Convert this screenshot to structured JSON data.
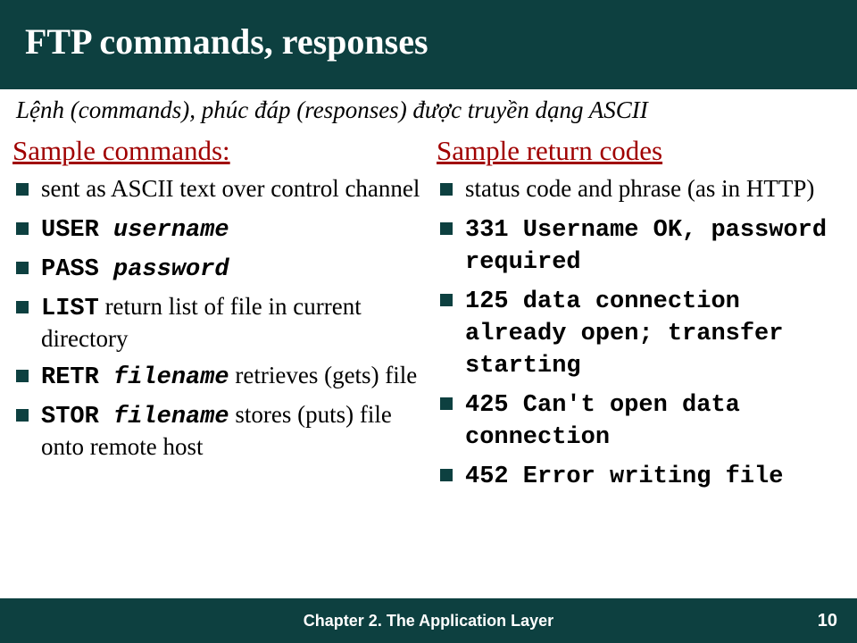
{
  "title": "FTP commands, responses",
  "subtitle": "Lệnh (commands), phúc đáp (responses) được truyền dạng ASCII",
  "left": {
    "heading": "Sample commands:",
    "items": [
      {
        "pre": "",
        "code": "",
        "codei": "",
        "post": "sent as ASCII text over control channel"
      },
      {
        "pre": "",
        "code": "USER ",
        "codei": "username",
        "post": ""
      },
      {
        "pre": "",
        "code": "PASS ",
        "codei": "password",
        "post": ""
      },
      {
        "pre": "",
        "code": "LIST",
        "codei": "",
        "post": " return list of file in current directory"
      },
      {
        "pre": "",
        "code": "RETR ",
        "codei": "filename",
        "post": " retrieves (gets) file"
      },
      {
        "pre": "",
        "code": "STOR ",
        "codei": "filename",
        "post": " stores (puts) file onto remote host"
      }
    ]
  },
  "right": {
    "heading": "Sample return codes",
    "items": [
      {
        "pre": "status code and phrase (as in HTTP)",
        "code": "",
        "codei": "",
        "post": ""
      },
      {
        "pre": "",
        "code": "331 Username OK, password required",
        "codei": "",
        "post": ""
      },
      {
        "pre": "",
        "code": "125 data connection already open; transfer starting",
        "codei": "",
        "post": ""
      },
      {
        "pre": "",
        "code": "425 Can't open data connection",
        "codei": "",
        "post": ""
      },
      {
        "pre": "",
        "code": "452 Error writing file",
        "codei": "",
        "post": ""
      }
    ]
  },
  "footer": {
    "chapter": "Chapter 2. The Application Layer",
    "page": "10"
  }
}
